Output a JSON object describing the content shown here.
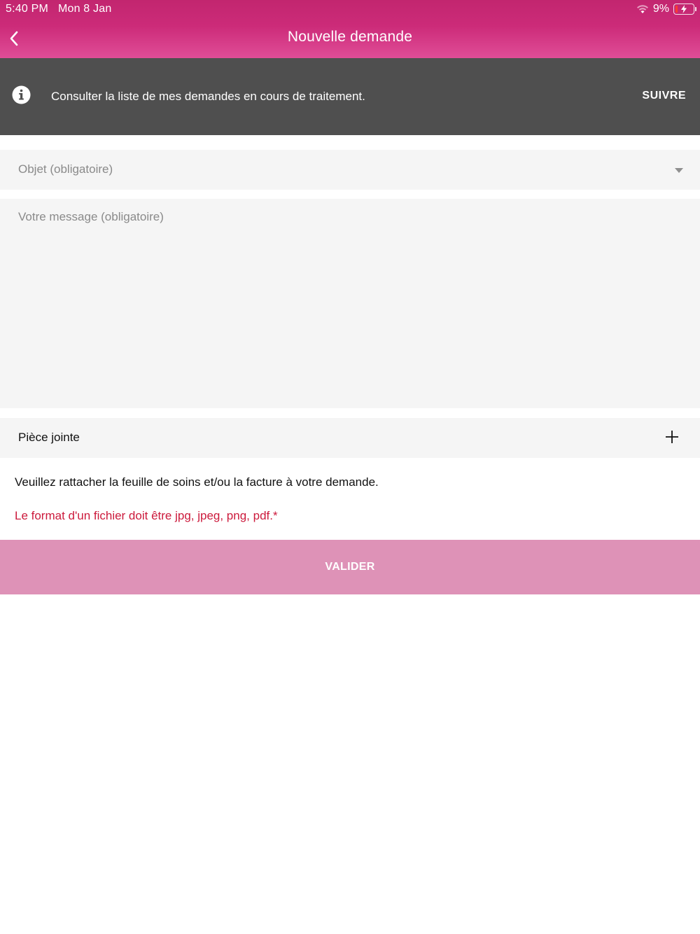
{
  "status_bar": {
    "time": "5:40 PM",
    "date": "Mon 8 Jan",
    "battery_percent": "9%",
    "wifi_icon": "wifi-icon",
    "battery_icon": "battery-charging-icon"
  },
  "header": {
    "title": "Nouvelle demande",
    "back_icon": "chevron-left-icon"
  },
  "info_banner": {
    "icon": "info-circle-icon",
    "text": "Consulter la liste de mes demandes en cours de traitement.",
    "action_label": "SUIVRE"
  },
  "form": {
    "object_placeholder": "Objet (obligatoire)",
    "message_placeholder": "Votre message (obligatoire)",
    "attachment_label": "Pièce jointe",
    "attachment_icon": "plus-icon",
    "instruction": "Veuillez rattacher la feuille de soins et/ou la facture à votre demande.",
    "format_note": "Le format d'un fichier doit être jpg, jpeg, png, pdf.*",
    "submit_label": "VALIDER"
  },
  "colors": {
    "header_top": "#c2266f",
    "header_bottom": "#e04d97",
    "banner_bg": "#4f4f4f",
    "field_bg": "#f5f5f5",
    "error_red": "#cc1a3c",
    "submit_bg": "#de92b7"
  }
}
